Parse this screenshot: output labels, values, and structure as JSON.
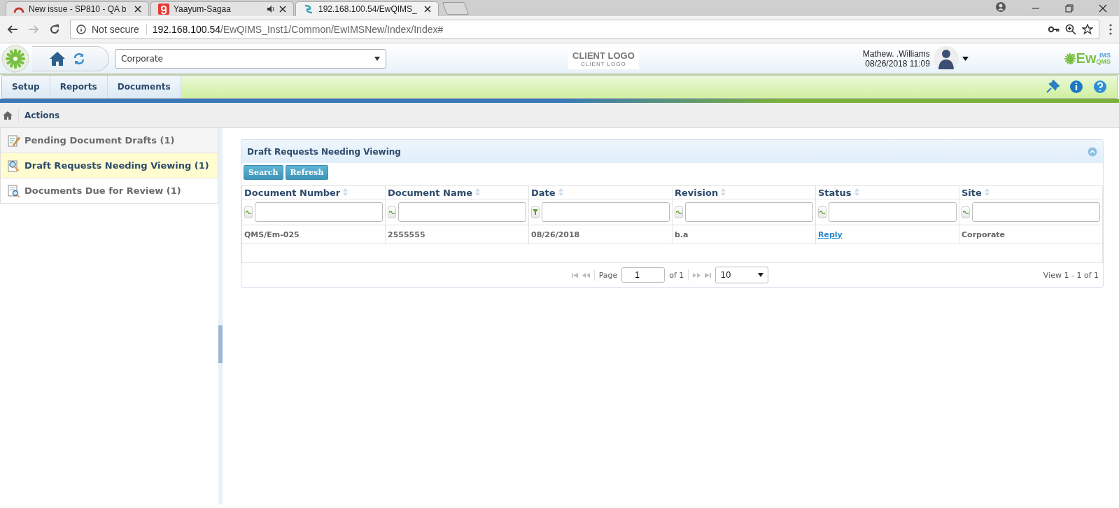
{
  "browser": {
    "tabs": [
      {
        "title": "New issue - SP810 - QA b",
        "kind": "issue",
        "selected": false,
        "audio": false
      },
      {
        "title": "Yaayum-Sagaa",
        "kind": "music",
        "selected": false,
        "audio": true
      },
      {
        "title": "192.168.100.54/EwQIMS_",
        "kind": "app",
        "selected": true,
        "audio": false
      }
    ],
    "address": {
      "security": "Not secure",
      "host": "192.168.100.54",
      "path": "/EwQIMS_Inst1/Common/EwIMSNew/Index/Index#"
    }
  },
  "header": {
    "site": "Corporate",
    "client_logo": {
      "title": "CLIENT LOGO",
      "subtitle": "CLIENT LOGO"
    },
    "user": {
      "name": "Mathew. .Williams",
      "datetime": "08/26/2018 11:09"
    },
    "brand": {
      "main": "Ew",
      "top": "IMS",
      "bottom": "QMS"
    }
  },
  "nav": [
    "Setup",
    "Reports",
    "Documents"
  ],
  "breadcrumb": "Actions",
  "sidebar": {
    "items": [
      {
        "label": "Pending Document Drafts (1)",
        "kind": "edit",
        "selected": false
      },
      {
        "label": "Draft Requests Needing Viewing (1)",
        "kind": "view",
        "selected": true
      },
      {
        "label": "Documents Due for Review (1)",
        "kind": "review",
        "selected": false
      }
    ]
  },
  "panel": {
    "title": "Draft Requests Needing Viewing",
    "buttons": [
      "Search",
      "Refresh"
    ],
    "columns": [
      {
        "label": "Document Number",
        "kind": "contains"
      },
      {
        "label": "Document Name",
        "kind": "contains"
      },
      {
        "label": "Date",
        "kind": "funnel"
      },
      {
        "label": "Revision",
        "kind": "contains"
      },
      {
        "label": "Status",
        "kind": "contains"
      },
      {
        "label": "Site",
        "kind": "contains"
      }
    ],
    "rows": [
      {
        "cells": [
          {
            "text": "QMS/Em-025",
            "kind": "text"
          },
          {
            "text": "2555555",
            "kind": "text"
          },
          {
            "text": "08/26/2018",
            "kind": "text"
          },
          {
            "text": "b.a",
            "kind": "text"
          },
          {
            "text": "Reply",
            "kind": "link"
          },
          {
            "text": "Corporate",
            "kind": "text"
          }
        ]
      }
    ],
    "pager": {
      "page_label": "Page",
      "page": "1",
      "of": "of 1",
      "page_size": "10",
      "view": "View 1 - 1 of 1"
    }
  }
}
